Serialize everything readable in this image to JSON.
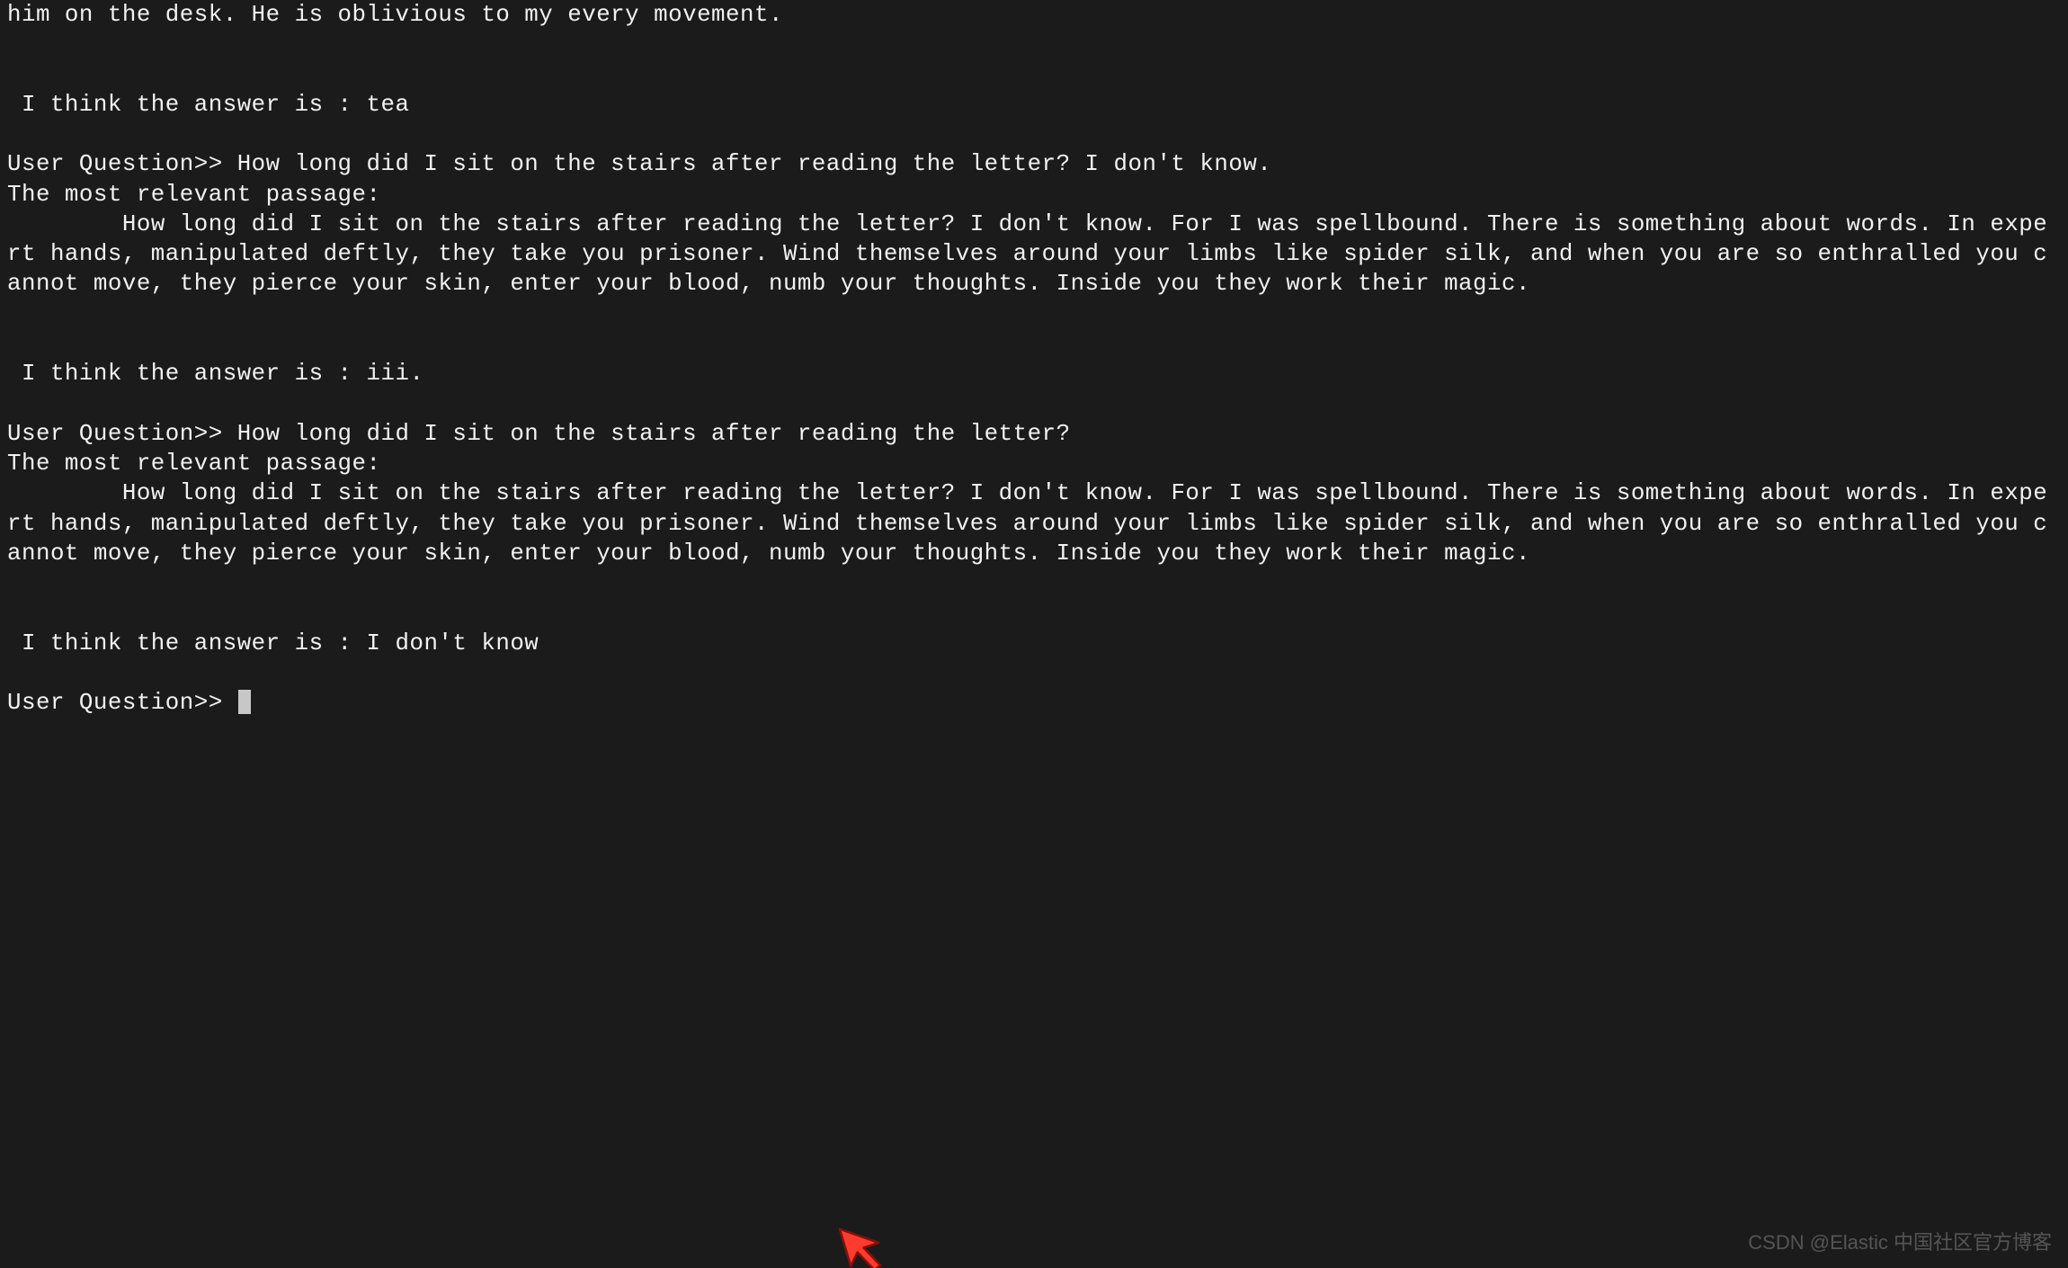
{
  "terminal": {
    "lines": [
      "him on the desk. He is oblivious to my every movement.",
      "",
      "",
      " I think the answer is : tea",
      "",
      "User Question>> How long did I sit on the stairs after reading the letter? I don't know.",
      "The most relevant passage: ",
      "        How long did I sit on the stairs after reading the letter? I don't know. For I was spellbound. There is something about words. In expert hands, manipulated deftly, they take you prisoner. Wind themselves around your limbs like spider silk, and when you are so enthralled you cannot move, they pierce your skin, enter your blood, numb your thoughts. Inside you they work their magic.",
      "",
      "",
      " I think the answer is : iii.",
      "",
      "User Question>> How long did I sit on the stairs after reading the letter?",
      "The most relevant passage: ",
      "        How long did I sit on the stairs after reading the letter? I don't know. For I was spellbound. There is something about words. In expert hands, manipulated deftly, they take you prisoner. Wind themselves around your limbs like spider silk, and when you are so enthralled you cannot move, they pierce your skin, enter your blood, numb your thoughts. Inside you they work their magic.",
      "",
      "",
      " I think the answer is : I don't know",
      ""
    ],
    "prompt": "User Question>> "
  },
  "watermark": "CSDN @Elastic 中国社区官方博客"
}
